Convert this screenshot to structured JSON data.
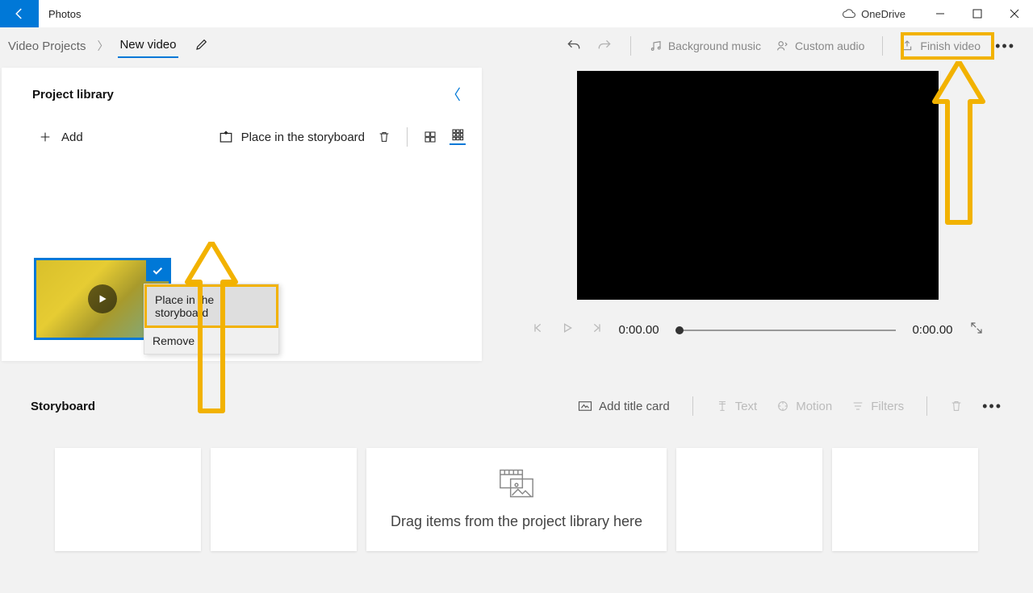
{
  "titlebar": {
    "app": "Photos",
    "onedrive": "OneDrive"
  },
  "breadcrumb": {
    "parent": "Video Projects",
    "current": "New video"
  },
  "toolbar": {
    "background_music": "Background music",
    "custom_audio": "Custom audio",
    "finish_video": "Finish video"
  },
  "library": {
    "title": "Project library",
    "add": "Add",
    "place": "Place in the storyboard"
  },
  "contextmenu": {
    "place": "Place in the storyboard",
    "remove": "Remove"
  },
  "player": {
    "current": "0:00.00",
    "duration": "0:00.00"
  },
  "storyboard": {
    "title": "Storyboard",
    "add_title": "Add title card",
    "text": "Text",
    "motion": "Motion",
    "filters": "Filters",
    "drag_hint": "Drag items from the project library here"
  }
}
